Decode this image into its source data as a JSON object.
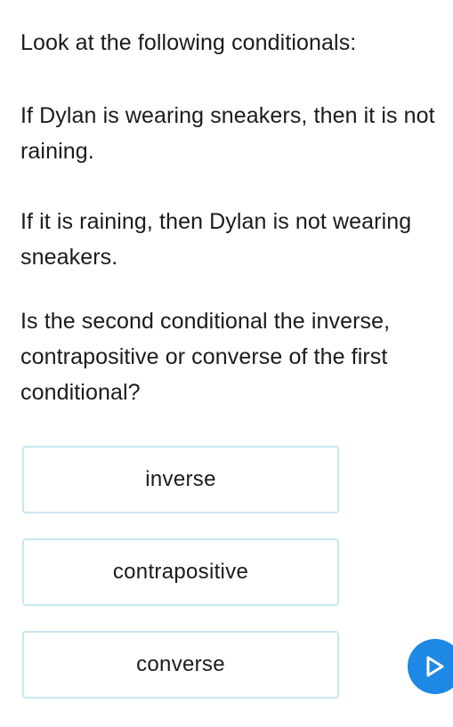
{
  "question": {
    "intro": "Look at the following conditionals:",
    "conditional_1": "If Dylan is wearing sneakers, then it is not raining.",
    "conditional_2": "If it is raining, then Dylan is not wearing sneakers.",
    "prompt": "Is the second conditional the inverse, contrapositive or converse of the first conditional?"
  },
  "options": [
    {
      "label": "inverse"
    },
    {
      "label": "contrapositive"
    },
    {
      "label": "converse"
    }
  ],
  "next_button": {
    "icon": "play-triangle-icon",
    "color": "#1e88e5"
  },
  "colors": {
    "option_border": "#c9e6f1",
    "text": "#1b1b1b",
    "accent": "#1e88e5"
  }
}
